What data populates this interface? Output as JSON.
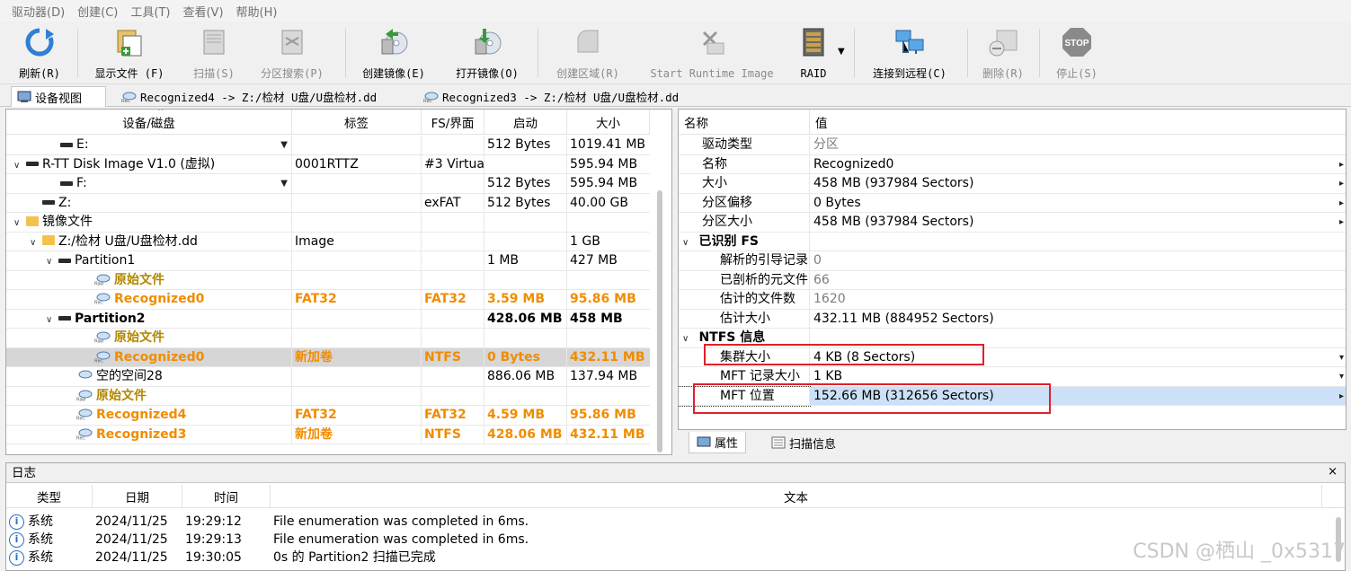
{
  "menu": [
    "驱动器(D)",
    "创建(C)",
    "工具(T)",
    "查看(V)",
    "帮助(H)"
  ],
  "toolbar": {
    "refresh": "刷新(R)",
    "show_files": "显示文件 (F)",
    "scan": "扫描(S)",
    "partition_search": "分区搜索(P)",
    "create_image": "创建镜像(E)",
    "open_image": "打开镜像(O)",
    "create_region": "创建区域(R)",
    "runtime": "Start Runtime Image",
    "raid": "RAID",
    "connect_remote": "连接到远程(C)",
    "delete": "删除(R)",
    "stop": "停止(S)",
    "stop_sign": "STOP"
  },
  "tabs": [
    "设备视图",
    "Recognized4 -> Z:/检材 U盘/U盘检材.dd",
    "Recognized3 -> Z:/检材 U盘/U盘检材.dd"
  ],
  "device": {
    "headers": [
      "设备/磁盘",
      "标签",
      "FS/界面",
      "启动",
      "大小"
    ],
    "rows": [
      {
        "name": "E:",
        "label": "",
        "fs": "",
        "start": "512 Bytes",
        "size": "1019.41 MB"
      },
      {
        "name": "R-TT Disk Image V1.0 (虚拟)",
        "label": "0001RTTZ",
        "fs": "#3 Virtual",
        "start": "",
        "size": "595.94 MB"
      },
      {
        "name": "F:",
        "label": "",
        "fs": "",
        "start": "512 Bytes",
        "size": "595.94 MB"
      },
      {
        "name": "Z:",
        "label": "",
        "fs": "exFAT",
        "start": "512 Bytes",
        "size": "40.00 GB"
      },
      {
        "name": "镜像文件",
        "label": "",
        "fs": "",
        "start": "",
        "size": ""
      },
      {
        "name": "Z:/检材 U盘/U盘检材.dd",
        "label": "Image",
        "fs": "",
        "start": "",
        "size": "1 GB"
      },
      {
        "name": "Partition1",
        "label": "",
        "fs": "",
        "start": "1 MB",
        "size": "427 MB"
      },
      {
        "name": "原始文件",
        "label": "",
        "fs": "",
        "start": "",
        "size": ""
      },
      {
        "name": "Recognized0",
        "label": "FAT32",
        "fs": "FAT32",
        "start": "3.59 MB",
        "size": "95.86 MB"
      },
      {
        "name": "Partition2",
        "label": "",
        "fs": "",
        "start": "428.06 MB",
        "size": "458 MB"
      },
      {
        "name": "原始文件",
        "label": "",
        "fs": "",
        "start": "",
        "size": ""
      },
      {
        "name": "Recognized0",
        "label": "新加卷",
        "fs": "NTFS",
        "start": "0 Bytes",
        "size": "432.11 MB"
      },
      {
        "name": "空的空间28",
        "label": "",
        "fs": "",
        "start": "886.06 MB",
        "size": "137.94 MB"
      },
      {
        "name": "原始文件",
        "label": "",
        "fs": "",
        "start": "",
        "size": ""
      },
      {
        "name": "Recognized4",
        "label": "FAT32",
        "fs": "FAT32",
        "start": "4.59 MB",
        "size": "95.86 MB"
      },
      {
        "name": "Recognized3",
        "label": "新加卷",
        "fs": "NTFS",
        "start": "428.06 MB",
        "size": "432.11 MB"
      }
    ]
  },
  "props": {
    "headers": [
      "名称",
      "值"
    ],
    "rows": [
      {
        "name": "驱动类型",
        "value": "分区"
      },
      {
        "name": "名称",
        "value": "Recognized0"
      },
      {
        "name": "大小",
        "value": "458 MB (937984 Sectors)"
      },
      {
        "name": "分区偏移",
        "value": "0 Bytes"
      },
      {
        "name": "分区大小",
        "value": "458 MB (937984 Sectors)"
      },
      {
        "name": "已识别 FS",
        "value": ""
      },
      {
        "name": "解析的引导记录",
        "value": "0"
      },
      {
        "name": "已剖析的元文件",
        "value": "66"
      },
      {
        "name": "估计的文件数",
        "value": "1620"
      },
      {
        "name": "估计大小",
        "value": "432.11 MB (884952 Sectors)"
      },
      {
        "name": "NTFS 信息",
        "value": ""
      },
      {
        "name": "集群大小",
        "value": "4 KB (8 Sectors)"
      },
      {
        "name": "MFT 记录大小",
        "value": "1 KB"
      },
      {
        "name": "MFT 位置",
        "value": "152.66 MB (312656 Sectors)"
      }
    ],
    "tabs": [
      "属性",
      "扫描信息"
    ]
  },
  "log": {
    "title": "日志",
    "close": "×",
    "headers": [
      "类型",
      "日期",
      "时间",
      "文本"
    ],
    "rows": [
      {
        "type": "系统",
        "date": "2024/11/25",
        "time": "19:29:12",
        "text": "File enumeration was completed in 6ms."
      },
      {
        "type": "系统",
        "date": "2024/11/25",
        "time": "19:29:13",
        "text": "File enumeration was completed in 6ms."
      },
      {
        "type": "系统",
        "date": "2024/11/25",
        "time": "19:30:05",
        "text": "0s 的 Partition2 扫描已完成"
      }
    ]
  },
  "watermark": "CSDN @栖山 _0x5317"
}
